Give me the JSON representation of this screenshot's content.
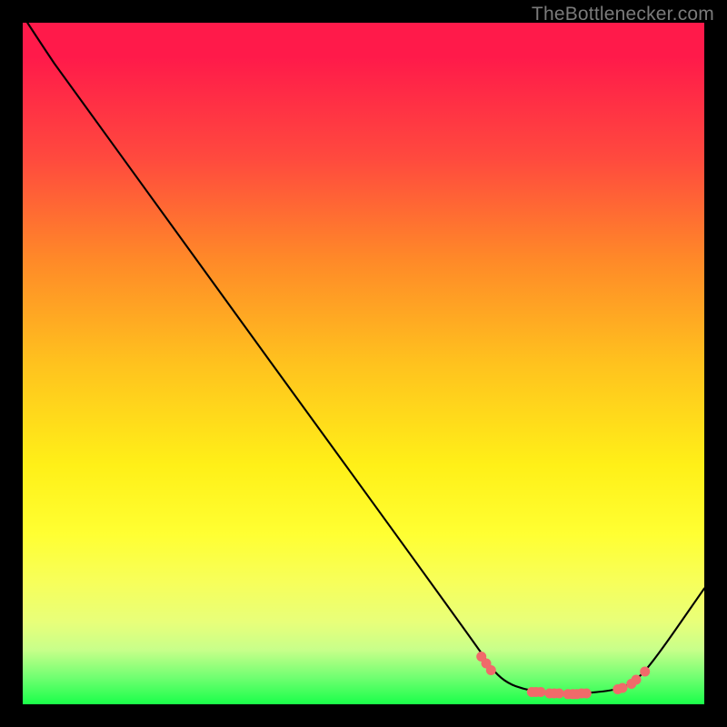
{
  "attribution": "TheBottlenecker.com",
  "chart_data": {
    "type": "line",
    "title": "",
    "xlabel": "",
    "ylabel": "",
    "xlim": [
      0,
      100
    ],
    "ylim": [
      0,
      100
    ],
    "series": [
      {
        "name": "bottleneck-curve",
        "x": [
          0.7,
          3.3,
          6.0,
          66.7,
          70.0,
          74.7,
          80.7,
          86.7,
          89.3,
          92.0,
          100.0
        ],
        "values": [
          100,
          96,
          92,
          8.5,
          3.5,
          1.8,
          1.5,
          2.0,
          3.0,
          5.5,
          17.0
        ]
      }
    ],
    "markers": {
      "name": "highlight-points",
      "x": [
        67.3,
        68.0,
        68.7,
        74.7,
        75.3,
        76.0,
        77.3,
        78.0,
        78.7,
        80.0,
        80.7,
        81.3,
        82.0,
        82.7,
        87.3,
        88.0,
        89.3,
        90.0,
        91.3
      ],
      "values": [
        7.0,
        6.0,
        5.0,
        1.8,
        1.8,
        1.8,
        1.6,
        1.6,
        1.6,
        1.5,
        1.5,
        1.5,
        1.6,
        1.6,
        2.2,
        2.4,
        3.0,
        3.6,
        4.8
      ]
    }
  }
}
